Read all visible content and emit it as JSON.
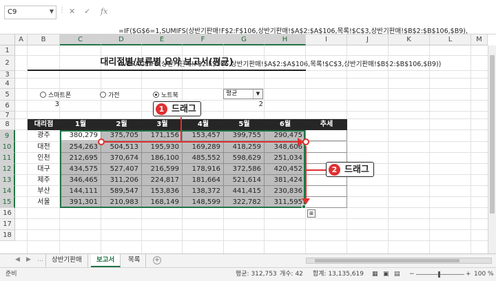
{
  "formula_bar": {
    "name_box": "C9",
    "cancel_icon": "✕",
    "enter_icon": "✓",
    "fx_label": "fx",
    "line1": "=IF($G$6=1,SUMIFS(상반기판매!F$2:F$106,상반기판매!$A$2:$A$106,목록!$C$3,상반기판매!$B$2:$B$106,$B9),",
    "line2": "AVERAGEIFS(상반기판매!F$2:F$106,상반기판매!$A$2:$A$106,목록!$C$3,상반기판매!$B$2:$B$106,$B9))"
  },
  "columns": [
    "A",
    "B",
    "C",
    "D",
    "E",
    "F",
    "G",
    "H",
    "I",
    "J",
    "K",
    "L",
    "M"
  ],
  "rows": [
    "1",
    "2",
    "3",
    "4",
    "5",
    "6",
    "7",
    "8",
    "9",
    "10",
    "11",
    "12",
    "13",
    "14",
    "15",
    "16",
    "17",
    "18"
  ],
  "sheet": {
    "title": "대리점별/분류별 요약 보고서(평균)",
    "options": [
      {
        "label": "스마트폰",
        "selected": false
      },
      {
        "label": "가전",
        "selected": false
      },
      {
        "label": "노트북",
        "selected": true
      }
    ],
    "combo_value": "평균",
    "b6_value": "3",
    "g6_value": "2",
    "headers": [
      "대리점",
      "1월",
      "2월",
      "3월",
      "4월",
      "5월",
      "6월",
      "추세"
    ],
    "table": [
      {
        "branch": "광주",
        "values": [
          "380,279",
          "375,705",
          "171,156",
          "153,457",
          "399,755",
          "290,475"
        ]
      },
      {
        "branch": "대전",
        "values": [
          "254,263",
          "504,513",
          "195,930",
          "169,289",
          "418,259",
          "348,606"
        ]
      },
      {
        "branch": "인천",
        "values": [
          "212,695",
          "370,674",
          "186,100",
          "485,552",
          "598,629",
          "251,034"
        ]
      },
      {
        "branch": "대구",
        "values": [
          "434,575",
          "527,407",
          "216,599",
          "178,916",
          "372,586",
          "420,452"
        ]
      },
      {
        "branch": "제주",
        "values": [
          "346,465",
          "311,206",
          "224,817",
          "181,664",
          "521,614",
          "381,424"
        ]
      },
      {
        "branch": "부산",
        "values": [
          "144,111",
          "589,547",
          "153,836",
          "138,372",
          "441,415",
          "230,836"
        ]
      },
      {
        "branch": "서울",
        "values": [
          "391,301",
          "210,983",
          "168,149",
          "148,599",
          "322,782",
          "311,595"
        ]
      }
    ]
  },
  "annotations": {
    "step1": {
      "number": "1",
      "label": "드래그"
    },
    "step2": {
      "number": "2",
      "label": "드래그"
    },
    "accent": "#e03030"
  },
  "tabs": [
    "상반기판매",
    "보고서",
    "목록"
  ],
  "active_tab": "보고서",
  "status": {
    "ready": "준비",
    "average": "평균: 312,753",
    "count": "개수: 42",
    "sum": "합계: 13,135,619",
    "zoom": "100 %"
  }
}
